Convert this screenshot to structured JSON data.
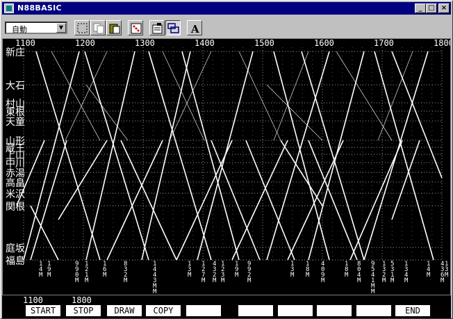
{
  "window": {
    "title": "N88BASIC",
    "controls": [
      "_",
      "□",
      "×"
    ]
  },
  "toolbar": {
    "mode_value": "自動",
    "tools": [
      {
        "name": "select-tool-button",
        "icon": "dotted-rectangle-icon",
        "pressed": false
      },
      {
        "name": "copy-tool-button",
        "icon": "copy-icon",
        "pressed": false
      },
      {
        "name": "paste-tool-button",
        "icon": "paste-icon",
        "pressed": false
      },
      {
        "name": "dice-tool-button",
        "icon": "dice-icon",
        "pressed": false
      },
      {
        "name": "properties-tool-button",
        "icon": "properties-icon",
        "pressed": false
      },
      {
        "name": "screen-tool-button",
        "icon": "screen-icon",
        "pressed": true
      },
      {
        "name": "font-tool-button",
        "icon": "font-a-icon",
        "pressed": false
      }
    ],
    "font_letter": "A"
  },
  "diagram": {
    "time_labels": [
      "1100",
      "1200",
      "1300",
      "1400",
      "1500",
      "1600",
      "1700",
      "1800"
    ],
    "stations": [
      "新庄",
      "大石",
      "村山",
      "東根",
      "天童",
      "山形",
      "蔵王",
      "上山",
      "中川",
      "赤湯",
      "高畠",
      "米沢",
      "関根",
      "庭坂",
      "福島"
    ],
    "train_numbers": [
      "14M",
      "19M",
      "990M",
      "121M",
      "16M",
      "832M",
      "1443MM",
      "13M",
      "127M",
      "432M",
      "123M",
      "19M",
      "992M",
      "13M",
      "18M",
      "409M",
      "18M",
      "804M",
      "9541MM",
      "132M",
      "531M",
      "134M",
      "14M",
      "436M",
      "13M"
    ]
  },
  "status": {
    "range_start": "1100",
    "range_end": "1800"
  },
  "function_keys": [
    "START",
    "STOP",
    "DRAW",
    "COPY",
    "",
    "",
    "",
    "",
    "",
    "END"
  ],
  "colors": {
    "title_bar": "#000080",
    "background": "#000000",
    "lines": "#ffffff",
    "grid": "#9a9a9a"
  }
}
